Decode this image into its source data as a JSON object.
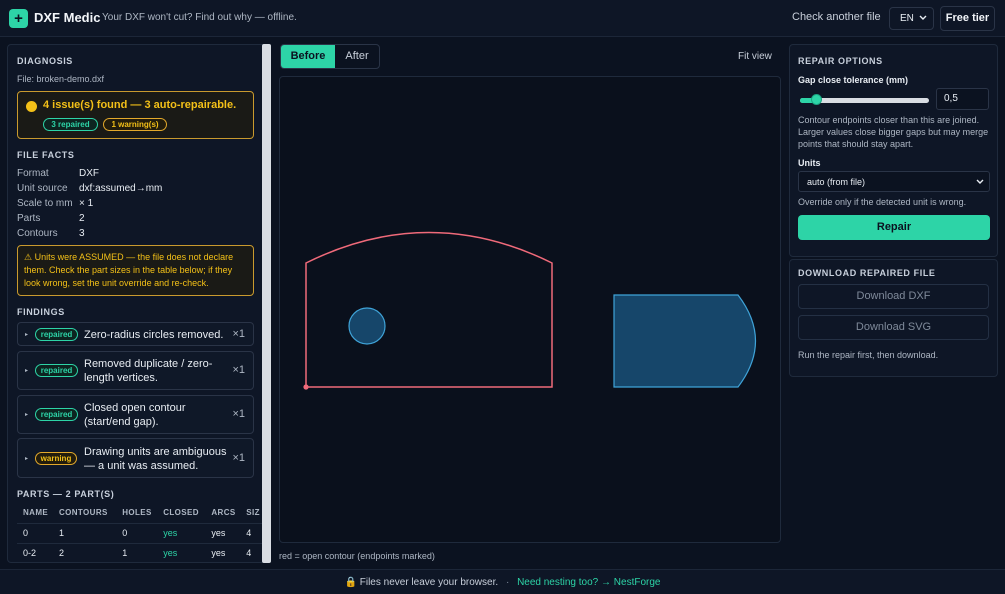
{
  "header": {
    "logo_glyph": "+",
    "title": "DXF Medic",
    "tagline": "Your DXF won't cut? Find out why — offline.",
    "check_another": "Check another file",
    "language": "EN",
    "free_tier": "Free tier"
  },
  "diagnosis": {
    "title": "DIAGNOSIS",
    "file": "File: broken-demo.dxf",
    "summary": "4 issue(s) found — 3 auto-repairable.",
    "repaired_pill": "3 repaired",
    "warning_pill": "1 warning(s)"
  },
  "file_facts": {
    "title": "FILE FACTS",
    "rows": [
      {
        "key": "Format",
        "value": "DXF"
      },
      {
        "key": "Unit source",
        "value": "dxf:assumed→mm"
      },
      {
        "key": "Scale to mm",
        "value": "× 1"
      },
      {
        "key": "Parts",
        "value": "2"
      },
      {
        "key": "Contours",
        "value": "3"
      }
    ],
    "warning": "⚠ Units were ASSUMED — the file does not declare them. Check the part sizes in the table below; if they look wrong, set the unit override and re-check."
  },
  "findings": {
    "title": "FINDINGS",
    "caret": "▸",
    "items": [
      {
        "badge": "repaired",
        "text": "Zero-radius circles removed.",
        "count": "×1"
      },
      {
        "badge": "repaired",
        "text": "Removed duplicate / zero-length vertices.",
        "count": "×1"
      },
      {
        "badge": "repaired",
        "text": "Closed open contour (start/end gap).",
        "count": "×1"
      },
      {
        "badge": "warning",
        "text": "Drawing units are ambiguous — a unit was assumed.",
        "count": "×1"
      }
    ]
  },
  "parts": {
    "title": "PARTS — 2 PART(S)",
    "columns": [
      "NAME",
      "CONTOURS",
      "HOLES",
      "CLOSED",
      "ARCS",
      "SIZ"
    ],
    "rows": [
      [
        "0",
        "1",
        "0",
        "yes",
        "yes",
        "4"
      ],
      [
        "0-2",
        "2",
        "1",
        "yes",
        "yes",
        "4"
      ]
    ]
  },
  "viewer": {
    "before": "Before",
    "after": "After",
    "fit_view": "Fit view",
    "legend": "red = open contour (endpoints marked)"
  },
  "repair_options": {
    "title": "REPAIR OPTIONS",
    "tolerance_label": "Gap close tolerance (mm)",
    "tolerance_value": "0,5",
    "slider_fraction": 0.13,
    "tolerance_help": "Contour endpoints closer than this are joined. Larger values close bigger gaps but may merge points that should stay apart.",
    "units_label": "Units",
    "units_value": "auto (from file)",
    "units_help": "Override only if the detected unit is wrong.",
    "repair_button": "Repair"
  },
  "download": {
    "title": "DOWNLOAD REPAIRED FILE",
    "dxf_button": "Download DXF",
    "svg_button": "Download SVG",
    "help": "Run the repair first, then download."
  },
  "footer": {
    "lock_icon": "🔒",
    "privacy": "Files never leave your browser.",
    "separator": "·",
    "link": "Need nesting too? → NestForge"
  },
  "colors": {
    "accent": "#2dd4a7",
    "warning": "#f3c018",
    "open_contour": "#f06a7a",
    "closed_contour": "#3fa3d8"
  }
}
